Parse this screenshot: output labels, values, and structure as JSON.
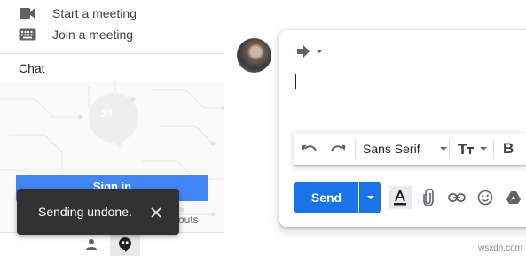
{
  "sidebar": {
    "meet_items": [
      {
        "label": "Start a meeting",
        "icon": "videocam-icon"
      },
      {
        "label": "Join a meeting",
        "icon": "keyboard-icon"
      }
    ],
    "chat_title": "Chat",
    "signin_label": "Sign in",
    "hangouts_suffix": "outs"
  },
  "snackbar": {
    "message": "Sending undone.",
    "close_icon": "close-icon"
  },
  "compose": {
    "reply_type_icon": "reply-forward-icon",
    "format_bar": {
      "font_name": "Sans Serif",
      "undo_icon": "undo-icon",
      "redo_icon": "redo-icon",
      "size_icon": "text-size-icon",
      "bold_label": "B"
    },
    "send_label": "Send",
    "bottom_icons": [
      "text-format-icon",
      "attach-icon",
      "link-icon",
      "emoji-icon",
      "drive-icon"
    ]
  },
  "watermark": "wsxdn.com",
  "colors": {
    "send": "#1a73e8",
    "signin": "#4285f4",
    "snackbar": "#323232"
  }
}
